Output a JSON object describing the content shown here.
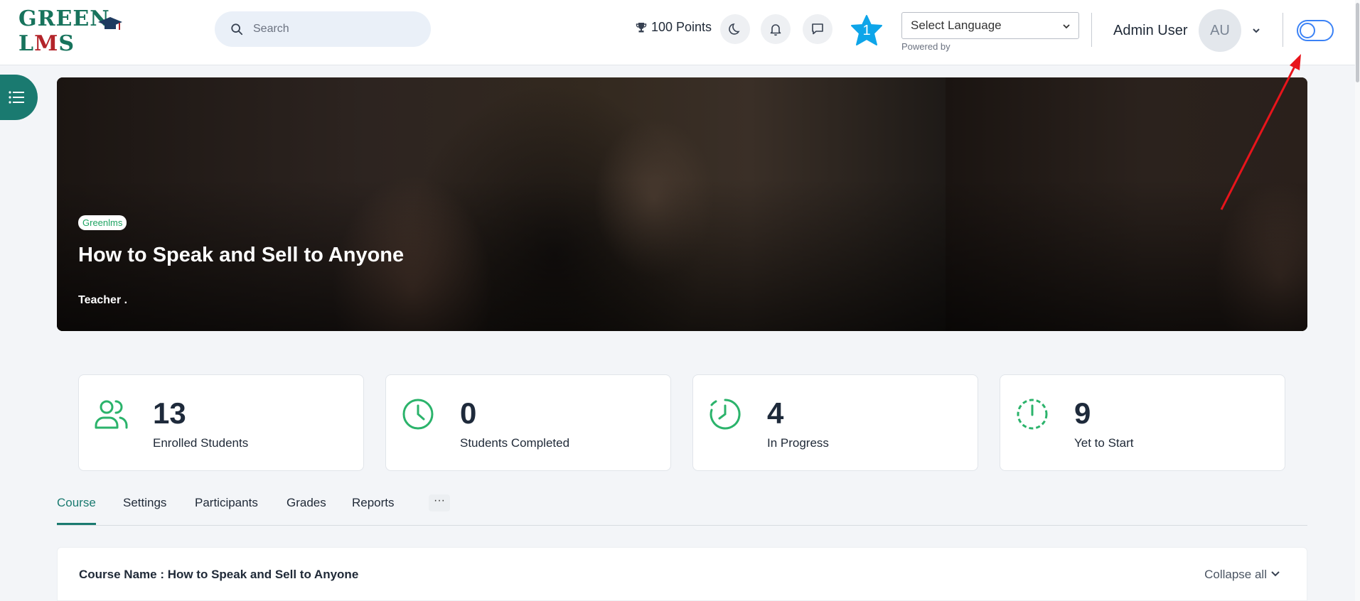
{
  "header": {
    "logo": {
      "part1": "GREEN L",
      "part2": "M",
      "part3": "S"
    },
    "search": {
      "placeholder": "Search"
    },
    "points_label": "100 Points",
    "star_count": "1",
    "language": {
      "selected": "Select Language",
      "powered_by": "Powered by"
    },
    "user": {
      "name": "Admin User",
      "initials": "AU"
    }
  },
  "banner": {
    "tag": "Greenlms",
    "title": "How to Speak and Sell to Anyone",
    "teacher": "Teacher ."
  },
  "stats": [
    {
      "value": "13",
      "label": "Enrolled Students",
      "icon": "users-icon"
    },
    {
      "value": "0",
      "label": "Students Completed",
      "icon": "clock-icon"
    },
    {
      "value": "4",
      "label": "In Progress",
      "icon": "clock-progress-icon"
    },
    {
      "value": "9",
      "label": "Yet to Start",
      "icon": "clock-dashed-icon"
    }
  ],
  "tabs": [
    {
      "label": "Course",
      "active": true
    },
    {
      "label": "Settings"
    },
    {
      "label": "Participants"
    },
    {
      "label": "Grades"
    },
    {
      "label": "Reports"
    }
  ],
  "tab_more": "···",
  "course": {
    "name_label": "Course Name : How to Speak and Sell to Anyone",
    "collapse_label": "Collapse all"
  },
  "colors": {
    "brand": "#1a7a70",
    "accent_green": "#2bb36b",
    "star": "#0ea5e9",
    "annotation": "#e8141b"
  }
}
